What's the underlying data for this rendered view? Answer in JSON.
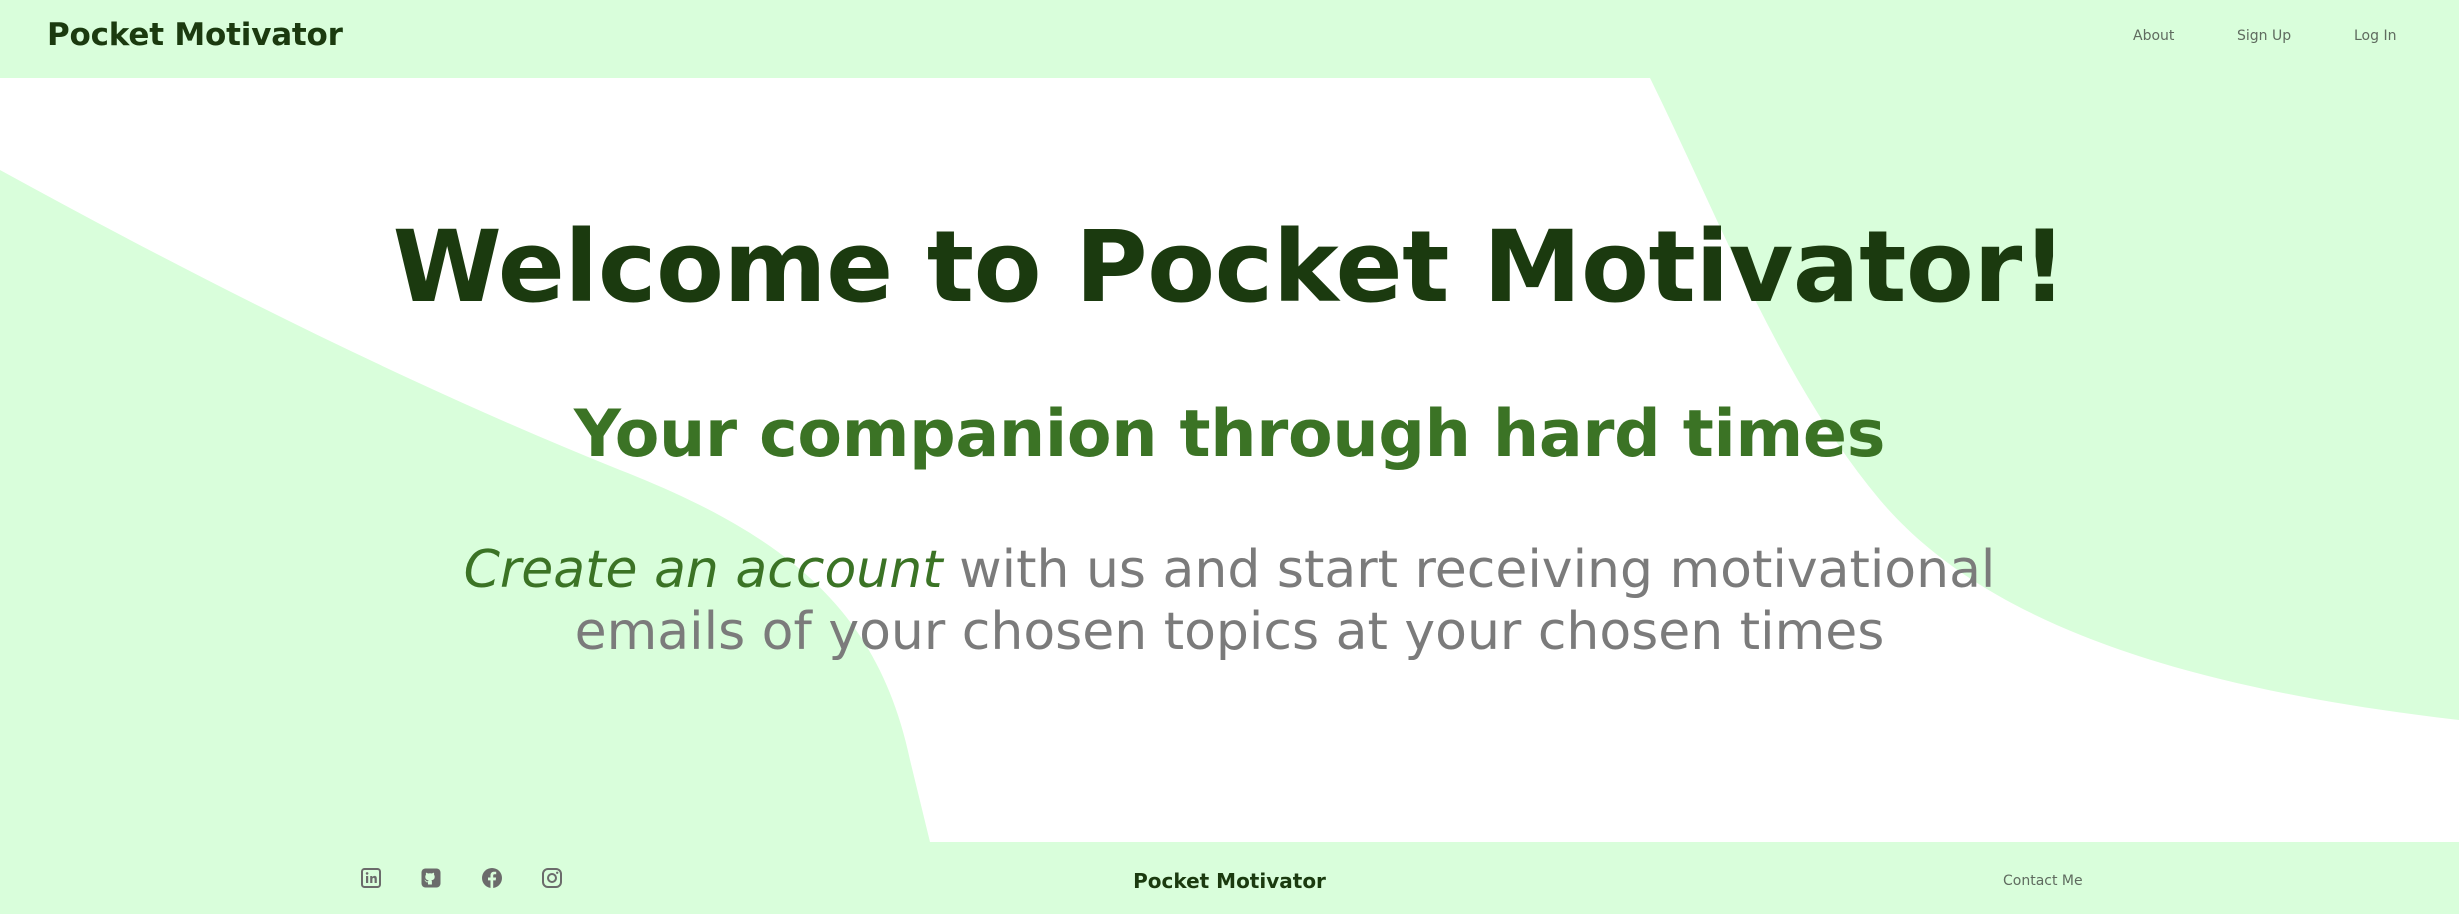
{
  "header": {
    "brand": "Pocket Motivator",
    "links": {
      "about": "About",
      "signup": "Sign Up",
      "login": "Log In"
    }
  },
  "hero": {
    "title": "Welcome to Pocket Motivator!",
    "subtitle": "Your companion through hard times",
    "cta_link": "Create an account",
    "body": " with us and start receiving motivational emails of your chosen topics at your chosen times"
  },
  "footer": {
    "social_icons": [
      "linkedin-icon",
      "github-icon",
      "facebook-icon",
      "instagram-icon"
    ],
    "brand": "Pocket Motivator",
    "contact": "Contact Me"
  },
  "colors": {
    "mint_background": "#d9fedb",
    "dark_green": "#1b3a0f",
    "accent_green": "#3b7325",
    "muted_gray": "#7b7b7b",
    "icon_gray": "#6b6b6b"
  }
}
